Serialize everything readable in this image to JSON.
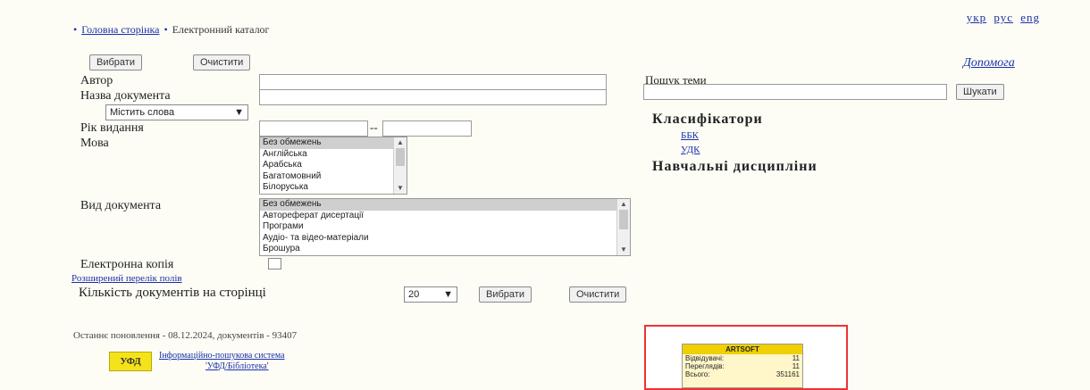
{
  "languages": [
    "укр",
    "рус",
    "eng"
  ],
  "breadcrumb": {
    "home": "Головна сторінка",
    "current": "Електронний каталог"
  },
  "buttons": {
    "select": "Вибрати",
    "clear": "Очистити"
  },
  "help_link": "Допомога",
  "fields": {
    "author": "Автор",
    "title": "Назва документа",
    "title_mode": "Містить слова",
    "year": "Рік видання",
    "year_sep": "--",
    "language": "Мова",
    "doc_type": "Вид документа",
    "electronic_copy": "Електронна копія"
  },
  "language_options": [
    "Без обмежень",
    "Англійська",
    "Арабська",
    "Багатомовний",
    "Білоруська"
  ],
  "doctype_options": [
    "Без обмежень",
    "Автореферат дисертації",
    "Програми",
    "Аудіо- та відео-матеріали",
    "Брошура"
  ],
  "extended_link": "Розширений перелік полів",
  "per_page_label": "Кількість документів на сторінці",
  "per_page_value": "20",
  "topic_search": {
    "label": "Пошук теми",
    "button": "Шукати"
  },
  "classifiers": {
    "heading": "Класифікатори",
    "items": [
      "ББК",
      "УДК"
    ]
  },
  "disciplines_heading": "Навчальні дисципліни",
  "footer": {
    "updated": "Останнє поновлення - 08.12.2024, документів - 93407",
    "system_link_line1": "Інформаційно-пошукова система",
    "system_link_line2": "'УФД/Бібліотека'",
    "logo_text": "УФД"
  },
  "counter": {
    "title": "ARTSOFT",
    "rows": [
      {
        "label": "Відвідувачі:",
        "value": "11"
      },
      {
        "label": "Переглядів:",
        "value": "11"
      },
      {
        "label": "Всього:",
        "value": "351161"
      }
    ]
  }
}
